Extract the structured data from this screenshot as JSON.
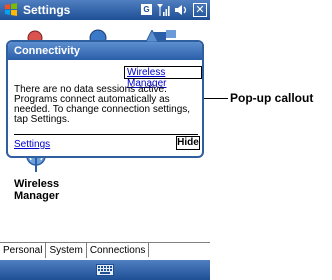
{
  "titlebar": {
    "title": "Settings",
    "icons": [
      "windows-flag-icon",
      "g-network-icon",
      "signal-icon",
      "volume-icon",
      "close-icon"
    ],
    "network_label": "G",
    "close_label": "✕"
  },
  "background": {
    "wireless_manager_label": "Wireless Manager"
  },
  "popup": {
    "title": "Connectivity",
    "top_link": "Wireless Manager",
    "message": "There are no data sessions active. Programs connect automatically as needed. To change connection settings, tap Settings.",
    "settings_link": "Settings",
    "hide_button": "Hide"
  },
  "tabs": [
    {
      "label": "Personal",
      "active": false
    },
    {
      "label": "System",
      "active": false
    },
    {
      "label": "Connections",
      "active": true
    }
  ],
  "callout": {
    "label": "Pop-up callout"
  },
  "colors": {
    "titlebar": "#2a5ea8",
    "link": "#0000cc"
  }
}
